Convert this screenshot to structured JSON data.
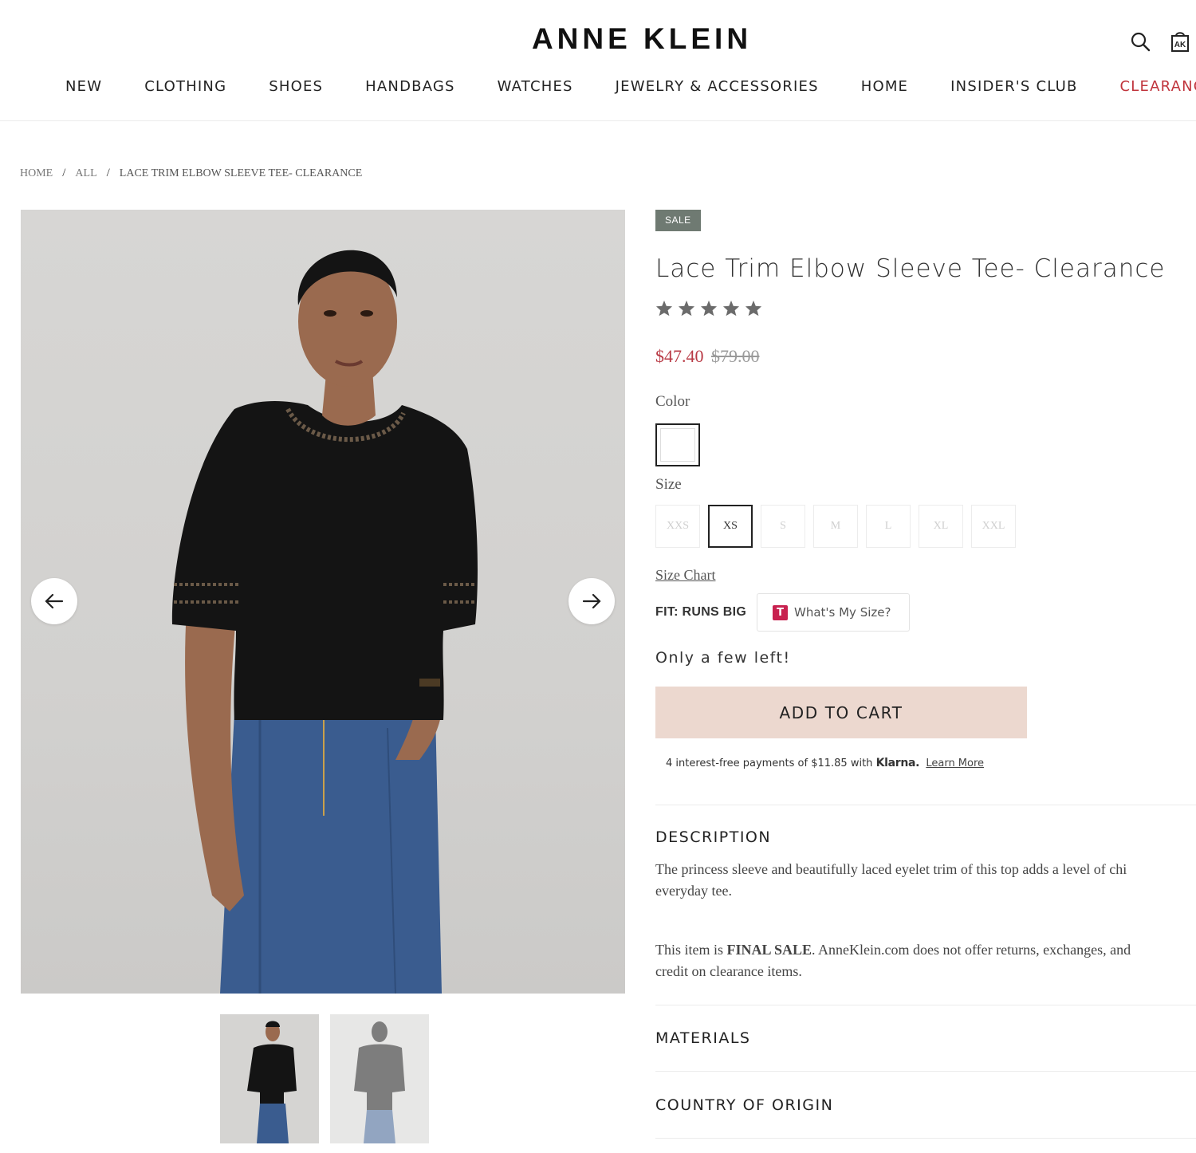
{
  "header": {
    "logo": "ANNE KLEIN",
    "nav": [
      "NEW",
      "CLOTHING",
      "SHOES",
      "HANDBAGS",
      "WATCHES",
      "JEWELRY & ACCESSORIES",
      "HOME",
      "INSIDER'S CLUB",
      "CLEARANC"
    ],
    "icons": [
      "search-icon",
      "cart-icon"
    ],
    "cart_icon_text": "AK"
  },
  "breadcrumb": [
    "HOME",
    "ALL",
    "LACE TRIM ELBOW SLEEVE TEE- CLEARANCE"
  ],
  "breadcrumb_sep": "/",
  "gallery": {
    "prev_icon": "arrow-left-icon",
    "next_icon": "arrow-right-icon",
    "thumbnail_count": 2,
    "selected_thumbnail": 1
  },
  "product": {
    "badge": "SALE",
    "title": "Lace Trim Elbow Sleeve Tee- Clearance",
    "rating": 5,
    "star_color": "#6b6b6b",
    "sale_price": "$47.40",
    "original_price": "$79.00",
    "sale_color": "#b93b46",
    "color_label": "Color",
    "size_label": "Size",
    "sizes": [
      "XXS",
      "XS",
      "S",
      "M",
      "L",
      "XL",
      "XXL"
    ],
    "selected_size": "XS",
    "size_chart": "Size Chart",
    "fit": "FIT: RUNS BIG",
    "whats_my_size": "What's My Size?",
    "whats_my_size_logo": "T",
    "stock": "Only a few left!",
    "add_to_cart": "ADD TO CART",
    "add_to_cart_color": "#ecd8cf",
    "klarna_text": "4 interest-free payments of $11.85 with",
    "klarna_brand": "Klarna.",
    "klarna_link": "Learn More"
  },
  "sections": {
    "description_title": "DESCRIPTION",
    "description_line1": "The princess sleeve and beautifully laced eyelet trim of this top adds a level of chi",
    "description_line2": "everyday tee.",
    "final_sale_pre": "This item is ",
    "final_sale_bold": "FINAL SALE",
    "final_sale_post": ". AnneKlein.com does not offer returns, exchanges, and",
    "final_sale_line2": "credit on clearance items.",
    "materials_title": "MATERIALS",
    "country_title": "COUNTRY OF ORIGIN"
  }
}
